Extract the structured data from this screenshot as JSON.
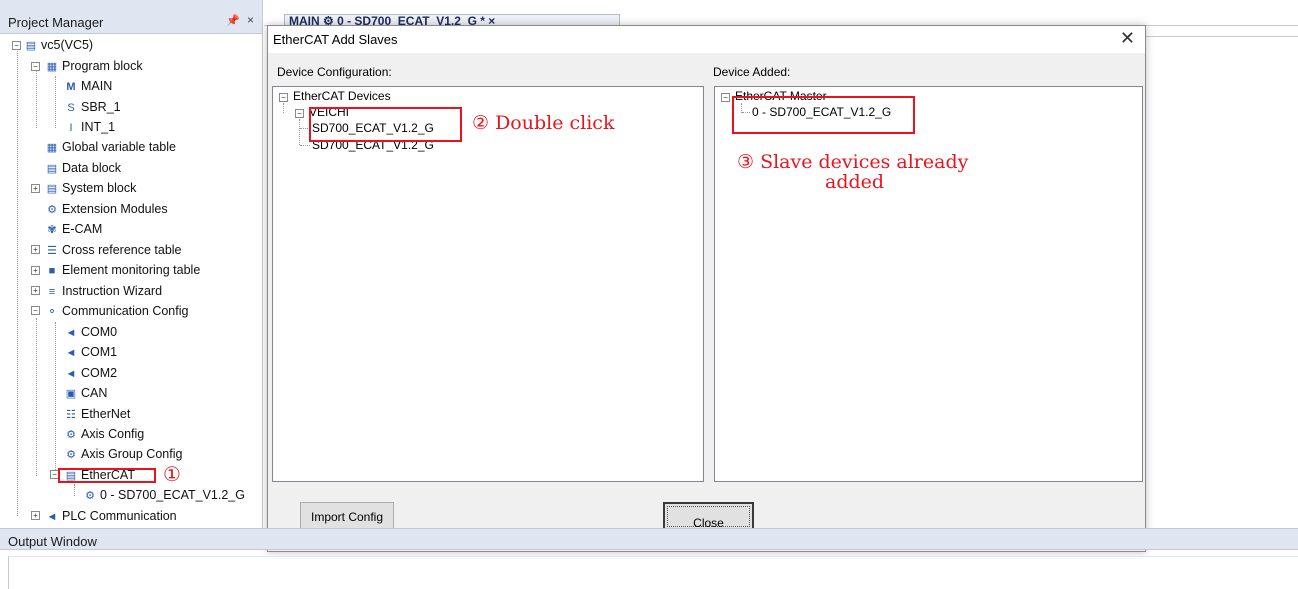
{
  "project_manager": {
    "title": "Project Manager",
    "pin_glyph": "—",
    "close_glyph": "×",
    "tree": {
      "root": "vc5(VC5)",
      "program_block": "Program block",
      "main": "MAIN",
      "sbr": "SBR_1",
      "int": "INT_1",
      "global_var": "Global variable table",
      "data_block": "Data block",
      "system_block": "System block",
      "extension": "Extension Modules",
      "ecam": "E-CAM",
      "cross_ref": "Cross reference table",
      "element_mon": "Element monitoring table",
      "instr_wizard": "Instruction Wizard",
      "comm_config": "Communication Config",
      "com0": "COM0",
      "com1": "COM1",
      "com2": "COM2",
      "can": "CAN",
      "ethernet": "EtherNet",
      "axis_config": "Axis Config",
      "axis_group": "Axis Group Config",
      "ethercat": "EtherCAT",
      "slave0": "0 - SD700_ECAT_V1.2_G",
      "plc_comm": "PLC Communication"
    }
  },
  "tabs": {
    "active_tab": "MAIN  ⚙  0 - SD700_ECAT_V1.2_G *  ×"
  },
  "dialog": {
    "title": "EtherCAT Add Slaves",
    "close_glyph": "✕",
    "device_config_label": "Device Configuration:",
    "device_added_label": "Device Added:",
    "config_tree": {
      "root": "EtherCAT Devices",
      "vendor": "VEICHI",
      "item1": "SD700_ECAT_V1.2_G",
      "item2": "SD700_ECAT_V1.2_G"
    },
    "added_tree": {
      "root": "EtherCAT Master",
      "item1": "0 - SD700_ECAT_V1.2_G"
    },
    "import_button": "Import Config",
    "close_button": "Close"
  },
  "annotations": {
    "step1": "①",
    "step2": "② Double click",
    "step3_line1": "③ Slave devices already",
    "step3_line2": "added",
    "color": "#e8141d"
  },
  "output_window": {
    "title": "Output Window"
  }
}
